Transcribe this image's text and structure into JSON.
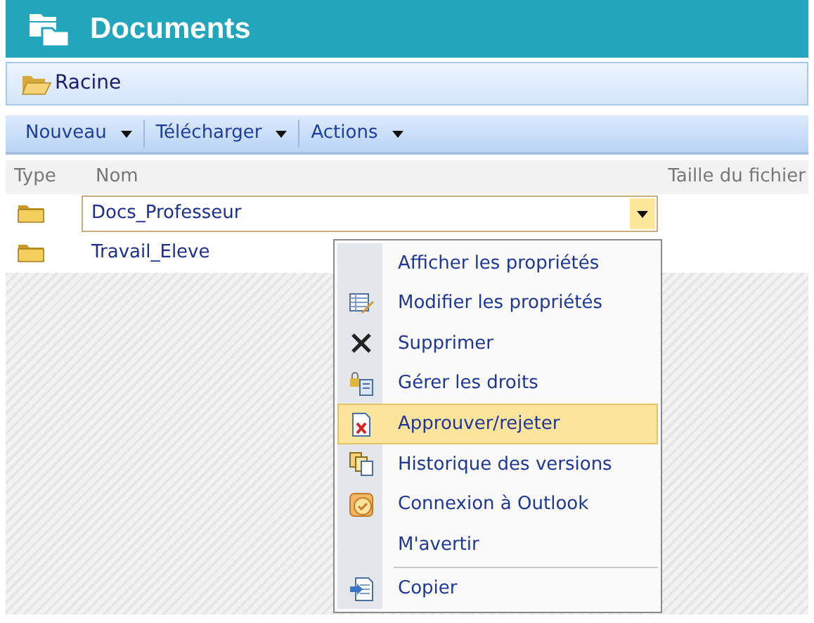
{
  "title": "Documents",
  "breadcrumb": "Racine",
  "toolbar": [
    {
      "label": "Nouveau",
      "has_caret": true
    },
    {
      "label": "Télécharger",
      "has_caret": true
    },
    {
      "label": "Actions",
      "has_caret": true
    }
  ],
  "columns": [
    "Type",
    "Nom",
    "Taille du fichier"
  ],
  "rows": [
    {
      "name": "Docs_Professeur",
      "selected": true
    },
    {
      "name": "Travail_Eleve",
      "selected": false
    }
  ],
  "menu": [
    {
      "label": "Afficher les propriétés",
      "selected": false,
      "separator_before": false
    },
    {
      "label": "Modifier les propriétés",
      "selected": false,
      "separator_before": false
    },
    {
      "label": "Supprimer",
      "selected": false,
      "separator_before": false
    },
    {
      "label": "Gérer les droits",
      "selected": false,
      "separator_before": false
    },
    {
      "label": "Approuver/rejeter",
      "selected": true,
      "separator_before": false
    },
    {
      "label": "Historique des versions",
      "selected": false,
      "separator_before": false
    },
    {
      "label": "Connexion à Outlook",
      "selected": false,
      "separator_before": false
    },
    {
      "label": "M'avertir",
      "selected": false,
      "separator_before": false
    },
    {
      "label": "Copier",
      "selected": false,
      "separator_before": true
    }
  ]
}
